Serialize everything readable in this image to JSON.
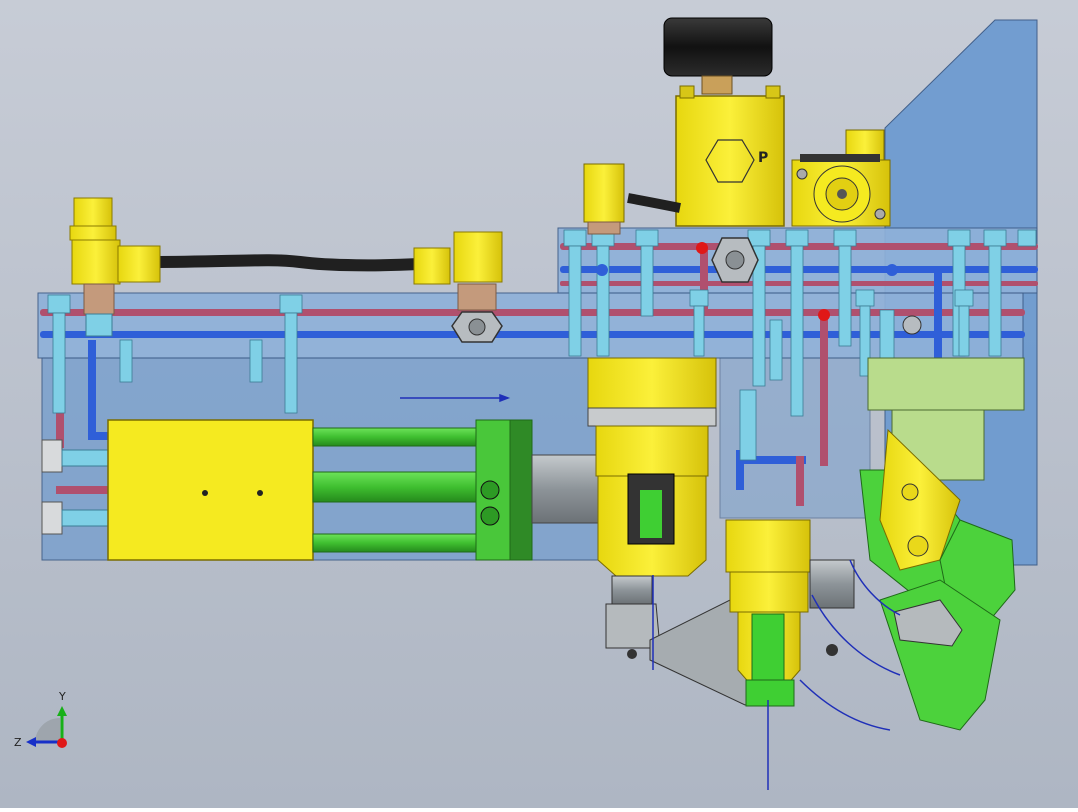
{
  "viewport": {
    "background_top": "#c7ccd6",
    "background_bottom": "#aeb6c3"
  },
  "part_labels": {
    "pressure_block_mark": "P"
  },
  "triad": {
    "y_label": "Y",
    "z_label": "Z",
    "x_axis_color": "#e01818",
    "y_axis_color": "#18b018",
    "z_axis_color": "#1830c8"
  },
  "colors": {
    "plate": "#7ea2cd",
    "plate_dark": "#5b82b6",
    "yellow": "#f2e61e",
    "yellow_dark": "#c9b40a",
    "green": "#4cd23c",
    "green_dark": "#2a9a22",
    "light_green": "#b9dc8c",
    "pipe_red": "#b0506e",
    "pipe_blue": "#2f5fd8",
    "bolt": "#7fd0e6",
    "steel": "#9aa1a6",
    "hose": "#202020"
  }
}
